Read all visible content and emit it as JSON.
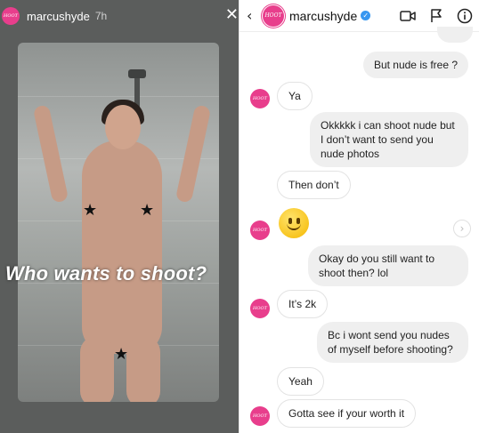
{
  "story": {
    "username": "marcushyde",
    "time": "7h",
    "avatar_text": "HOOT",
    "close_glyph": "✕",
    "caption": "Who wants to shoot?",
    "star_glyph": "★"
  },
  "dm": {
    "username": "marcushyde",
    "avatar_text": "HOOT",
    "back_glyph": "‹",
    "messages": [
      {
        "dir": "out",
        "text": "But nude is free ?"
      },
      {
        "dir": "in",
        "text": "Ya"
      },
      {
        "dir": "out",
        "text": "Okkkkk i can shoot nude but I don’t want to send you nude photos"
      },
      {
        "dir": "in",
        "text": "Then don’t"
      },
      {
        "dir": "in",
        "text": ""
      },
      {
        "dir": "out",
        "text": "Okay do you still want to shoot then? lol"
      },
      {
        "dir": "in",
        "text": "It’s 2k"
      },
      {
        "dir": "out",
        "text": "Bc i wont send you nudes of myself before shooting?"
      },
      {
        "dir": "in",
        "text": "Yeah"
      },
      {
        "dir": "in",
        "text": "Gotta see if your worth it"
      }
    ]
  },
  "colors": {
    "accent_pink": "#e83e8c",
    "verified_blue": "#3897f0",
    "bubble_out": "#efefef"
  },
  "icons": [
    "back-icon",
    "verified-icon",
    "video-call-icon",
    "flag-icon",
    "info-icon",
    "close-icon",
    "share-icon",
    "smiley-emoji"
  ]
}
